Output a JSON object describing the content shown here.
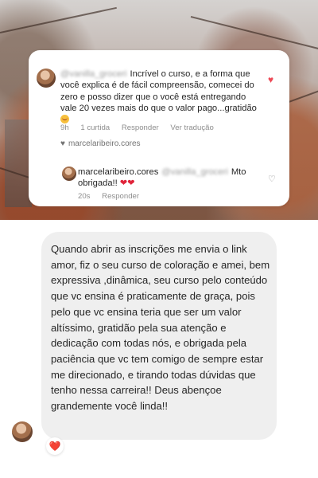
{
  "comment": {
    "author": "@vanilla_groceri",
    "text": "Incrível o curso, e a forma que você explica é de fácil compreensão, comecei do zero e posso dizer que o você está entregando vale 20 vezes mais do que o valor pago...gratidão",
    "time": "9h",
    "likes": "1 curtida",
    "reply_label": "Responder",
    "translate_label": "Ver tradução",
    "liked_by": "marcelaribeiro.cores"
  },
  "reply": {
    "author": "marcelaribeiro.cores",
    "mention": "@vanilla_groceri",
    "text": "Mto obrigada!!",
    "time": "20s",
    "reply_label": "Responder"
  },
  "dm": {
    "message": "Quando abrir as inscrições me envia o link amor, fiz o seu curso de coloração e amei, bem expressiva ,dinâmica, seu curso pelo conteúdo que vc ensina é praticamente de graça,  pois pelo que vc ensina teria que ser um valor altíssimo,  gratidão pela sua atenção e dedicação com todas nós,  e obrigada pela paciência que vc tem comigo de sempre estar me direcionado, e tirando todas dúvidas que tenho nessa carreira!! Deus abençoe grandemente você linda!!",
    "reaction": "❤️"
  },
  "colors": {
    "heart": "#ed4956",
    "bubble": "#efefef",
    "meta_text": "#8e8e8e"
  },
  "icons": {
    "comment_like": "heart-icon",
    "reply_like": "heart-outline-icon",
    "liked_by": "heart-icon"
  }
}
